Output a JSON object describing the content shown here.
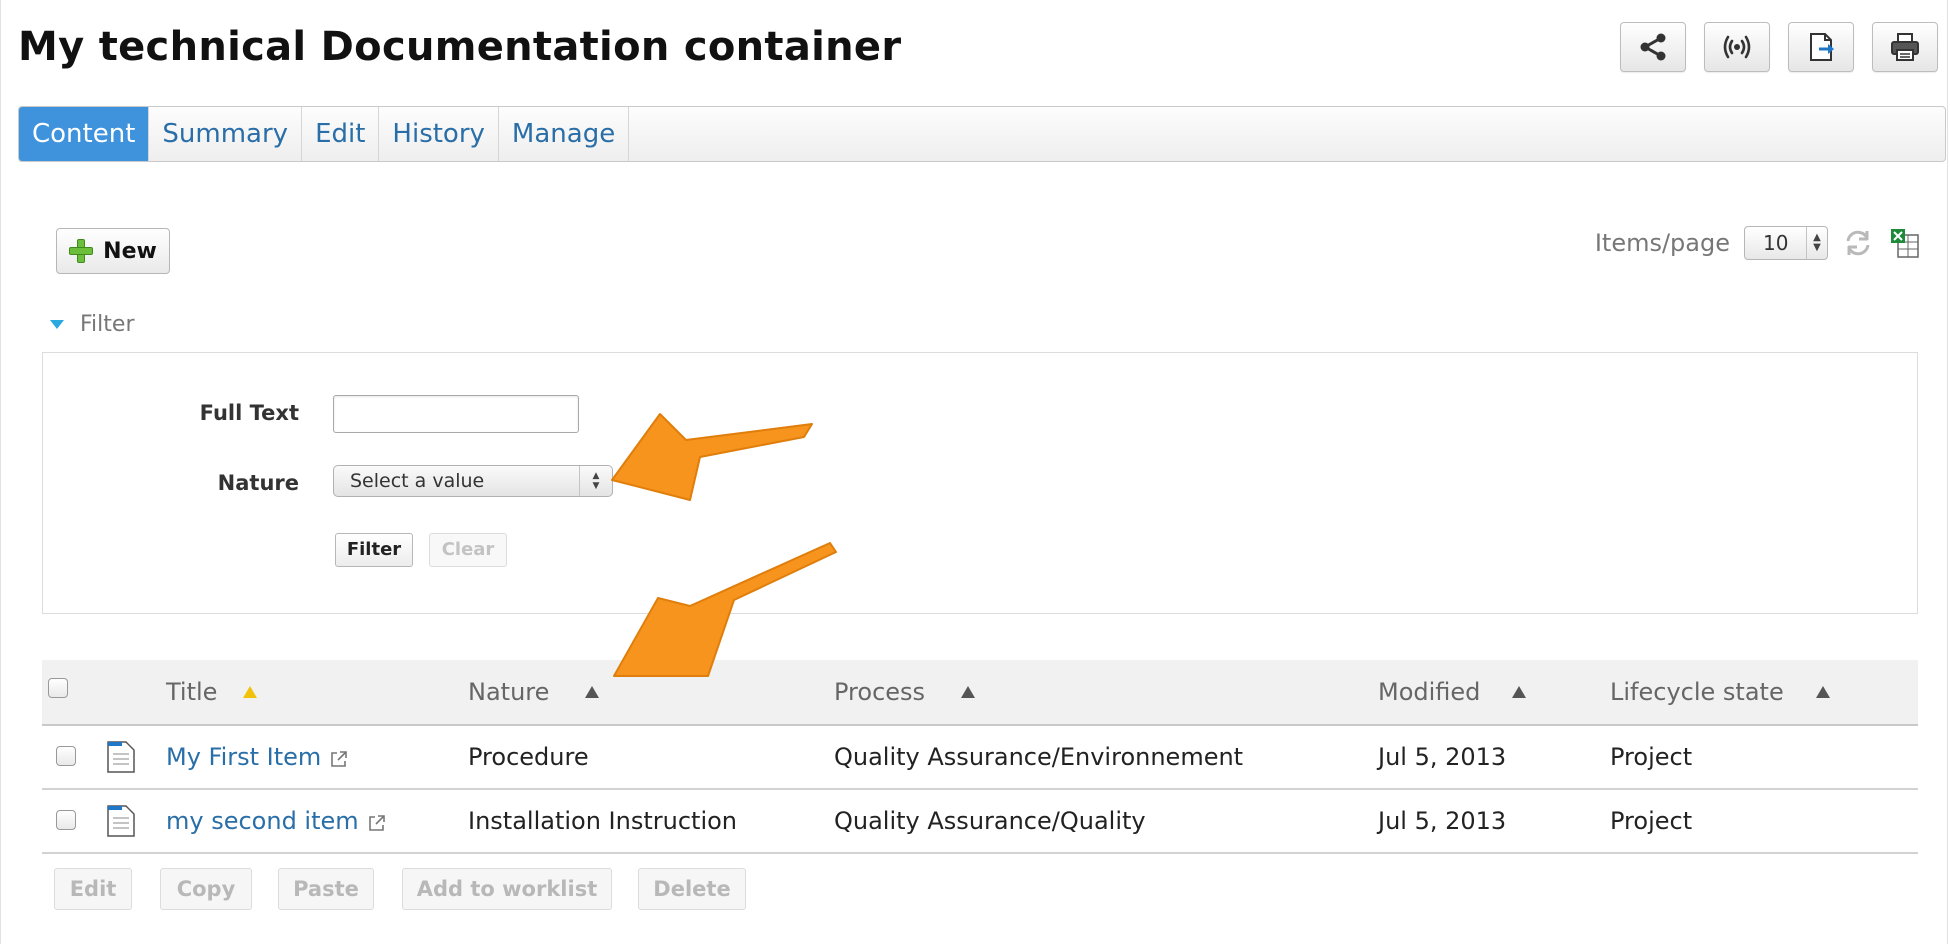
{
  "page": {
    "title": "My technical Documentation container"
  },
  "tabs": [
    {
      "label": "Content",
      "active": true
    },
    {
      "label": "Summary",
      "active": false
    },
    {
      "label": "Edit",
      "active": false
    },
    {
      "label": "History",
      "active": false
    },
    {
      "label": "Manage",
      "active": false
    }
  ],
  "top_actions": [
    "share-icon",
    "broadcast-icon",
    "export-document-icon",
    "printer-icon"
  ],
  "toolbar": {
    "new_label": "New",
    "items_per_page_label": "Items/page",
    "items_per_page_value": "10"
  },
  "filter": {
    "toggle_label": "Filter",
    "full_text_label": "Full Text",
    "full_text_value": "",
    "nature_label": "Nature",
    "nature_selected": "Select a value",
    "filter_button": "Filter",
    "clear_button": "Clear"
  },
  "table": {
    "columns": [
      "Title",
      "Nature",
      "Process",
      "Modified",
      "Lifecycle state"
    ],
    "rows": [
      {
        "title": "My First Item",
        "nature": "Procedure",
        "process": "Quality Assurance/Environnement",
        "modified": "Jul 5, 2013",
        "state": "Project"
      },
      {
        "title": "my second item",
        "nature": "Installation Instruction",
        "process": "Quality Assurance/Quality",
        "modified": "Jul 5, 2013",
        "state": "Project"
      }
    ]
  },
  "bulk_actions": [
    "Edit",
    "Copy",
    "Paste",
    "Add to worklist",
    "Delete"
  ],
  "colors": {
    "accent": "#3f93dc",
    "link": "#2a6ea8",
    "callout": "#f7941d"
  }
}
